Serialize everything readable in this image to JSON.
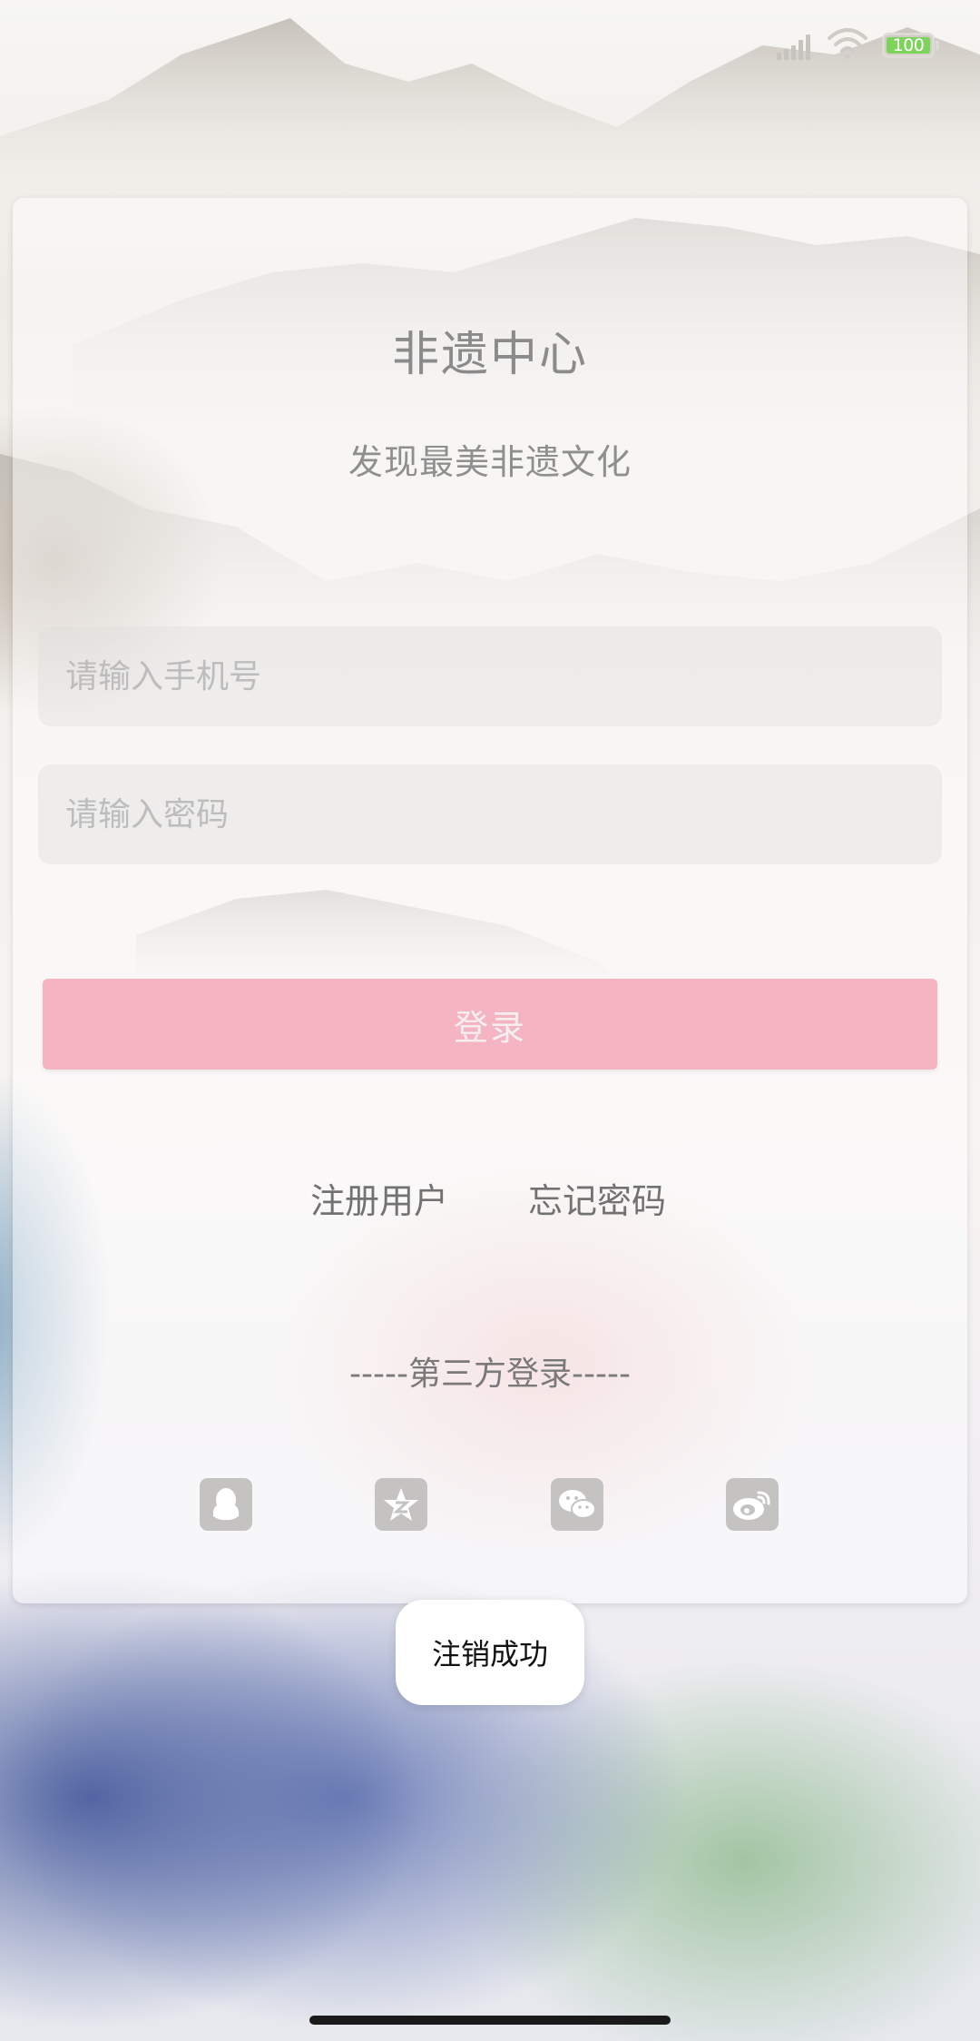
{
  "status_bar": {
    "battery": "100"
  },
  "app": {
    "title": "非遗中心",
    "subtitle": "发现最美非遗文化"
  },
  "form": {
    "phone_placeholder": "请输入手机号",
    "phone_value": "",
    "password_placeholder": "请输入密码",
    "password_value": "",
    "login_label": "登录"
  },
  "links": {
    "register": "注册用户",
    "forgot_password": "忘记密码"
  },
  "third_party": {
    "heading": "-----第三方登录-----",
    "providers": [
      "qq-icon",
      "qzone-icon",
      "wechat-icon",
      "weibo-icon"
    ]
  },
  "toast": {
    "message": "注销成功"
  },
  "colors": {
    "login_button": "#f4a0b4",
    "battery_fill": "#7ed35b"
  }
}
